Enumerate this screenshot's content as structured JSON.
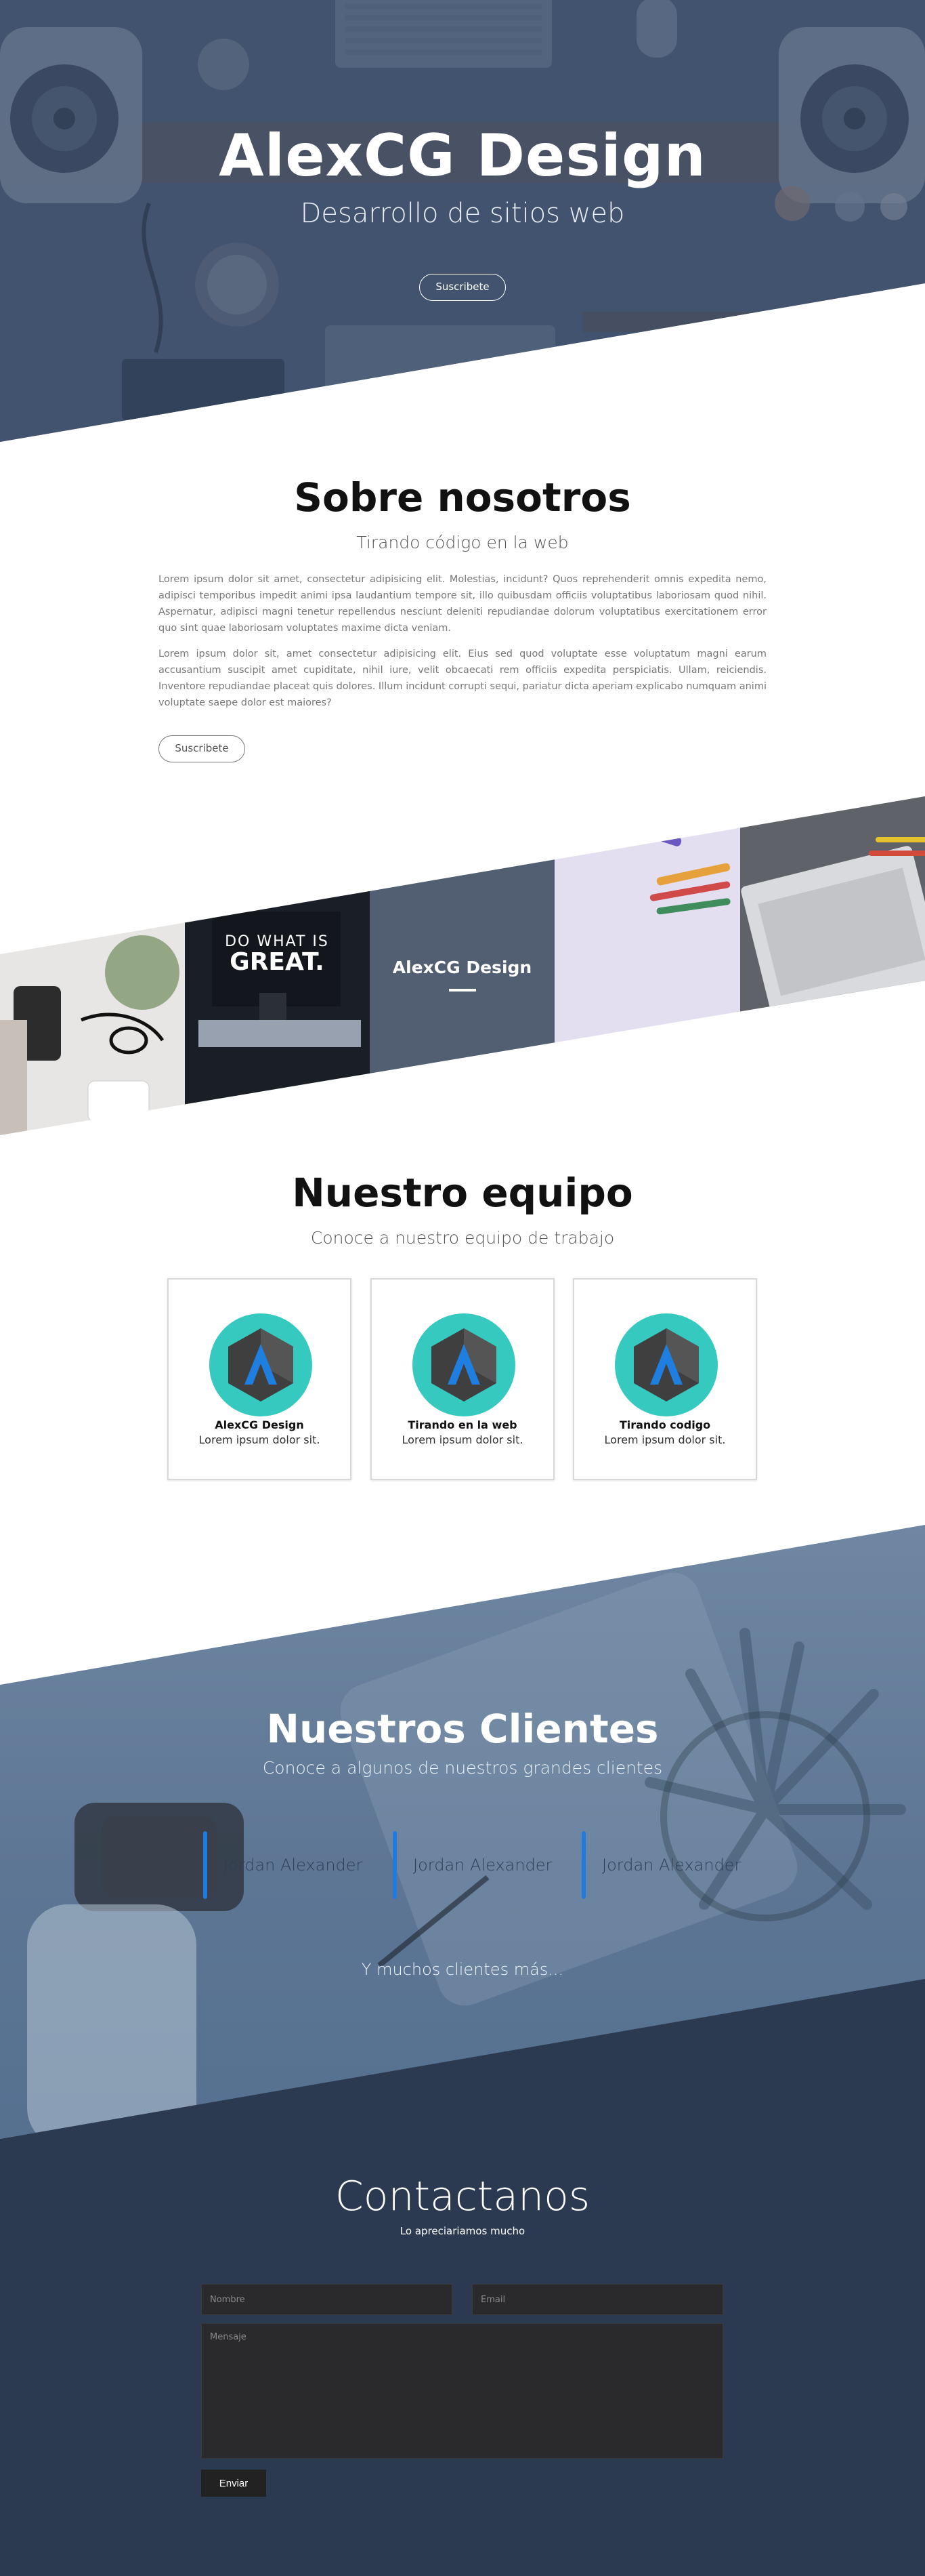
{
  "hero": {
    "title": "AlexCG Design",
    "subtitle": "Desarrollo de sitios web",
    "button": "Suscribete"
  },
  "about": {
    "title": "Sobre nosotros",
    "subtitle": "Tirando código en la web",
    "paragraph1": "Lorem ipsum dolor sit amet, consectetur adipisicing elit. Molestias, incidunt? Quos reprehenderit omnis expedita nemo, adipisci temporibus impedit animi ipsa laudantium tempore sit, illo quibusdam officiis voluptatibus laboriosam quod nihil. Aspernatur, adipisci magni tenetur repellendus nesciunt deleniti repudiandae dolorum voluptatibus exercitationem error quo sint quae laboriosam voluptates maxime dicta veniam.",
    "paragraph2": "Lorem ipsum dolor sit, amet consectetur adipisicing elit. Eius sed quod voluptate esse voluptatum magni earum accusantium suscipit amet cupiditate, nihil iure, velit obcaecati rem officiis expedita perspiciatis. Ullam, reiciendis. Inventore repudiandae placeat quis dolores. Illum incidunt corrupti sequi, pariatur dicta aperiam explicabo numquam animi voluptate saepe dolor est maiores?",
    "button": "Suscribete"
  },
  "gallery": {
    "center_label": "AlexCG Design",
    "poster_line1": "DO WHAT IS",
    "poster_line2": "GREAT."
  },
  "team": {
    "title": "Nuestro equipo",
    "subtitle": "Conoce a nuestro equipo de trabajo",
    "members": [
      {
        "name": "AlexCG Design",
        "desc": "Lorem ipsum dolor sit."
      },
      {
        "name": "Tirando en la web",
        "desc": "Lorem ipsum dolor sit."
      },
      {
        "name": "Tirando codigo",
        "desc": "Lorem ipsum dolor sit."
      }
    ],
    "logo_colors": {
      "circle": "#35c9c0",
      "hex_dark": "#3f3f3f",
      "letter": "#1f7fe0"
    }
  },
  "clients": {
    "title": "Nuestros Clientes",
    "subtitle": "Conoce a algunos de nuestros grandes clientes",
    "items": [
      "Jordan Alexander",
      "Jordan Alexander",
      "Jordan Alexander"
    ],
    "more": "Y muchos clientes más...",
    "accent": "#1e7be0"
  },
  "contact": {
    "title": "Contactanos",
    "subtitle": "Lo apreciariamos mucho",
    "name_placeholder": "Nombre",
    "email_placeholder": "Email",
    "message_placeholder": "Mensaje",
    "send": "Enviar",
    "bg_color": "#2b3a50"
  }
}
